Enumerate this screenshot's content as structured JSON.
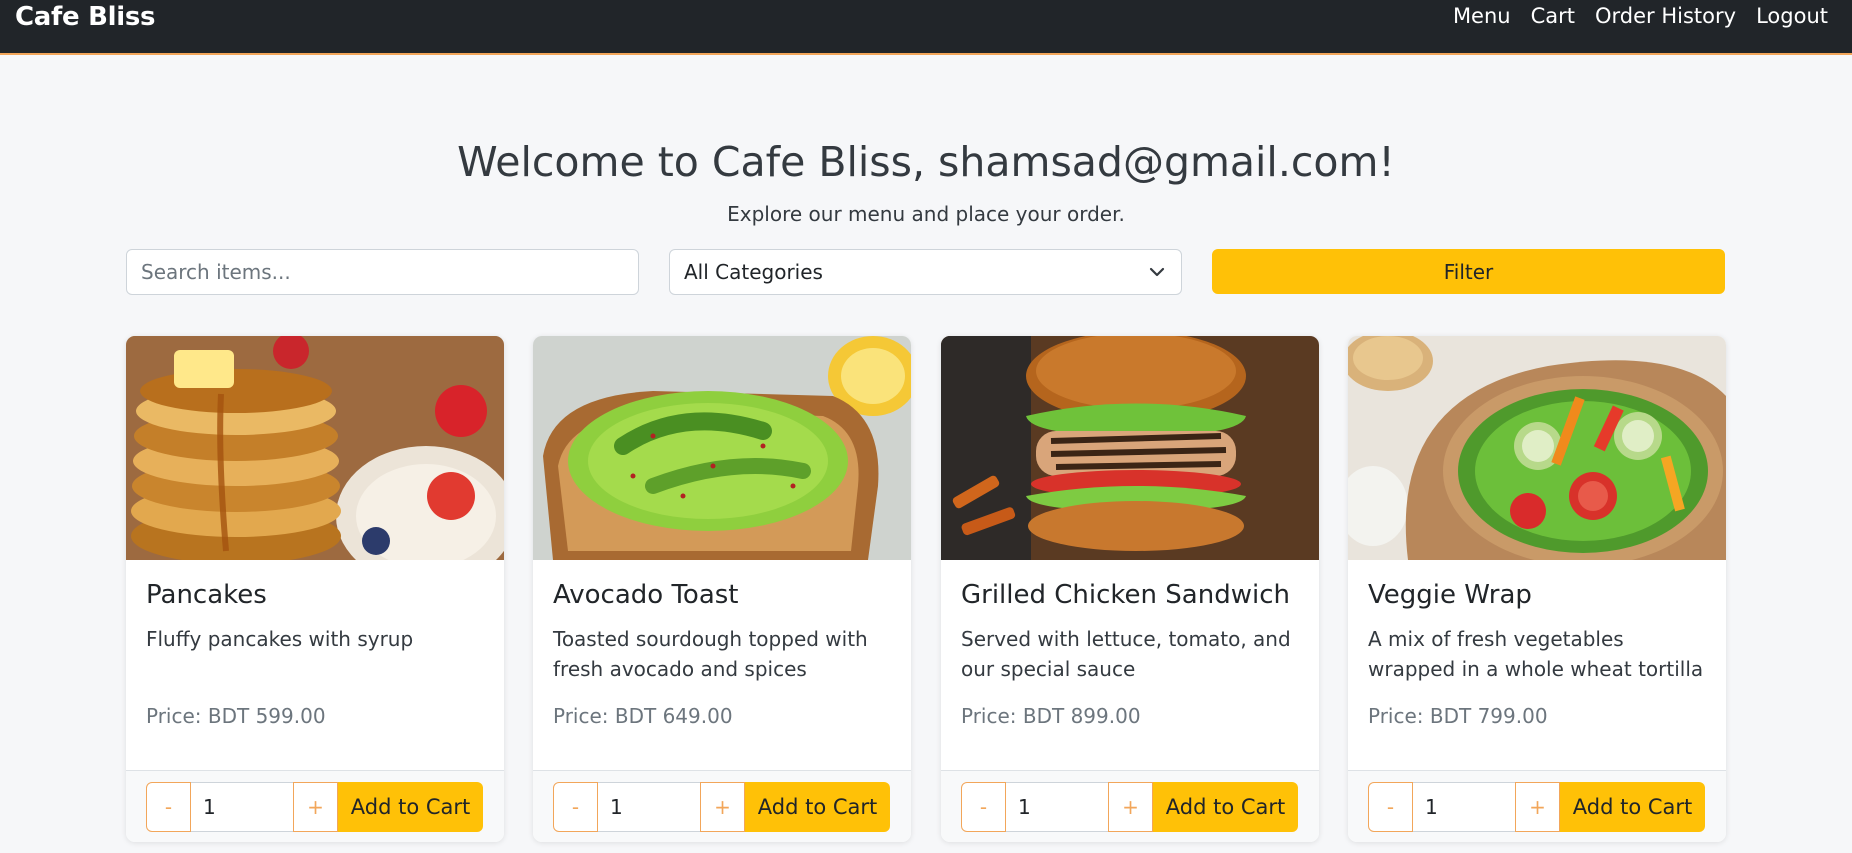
{
  "app": {
    "brand": "Cafe Bliss"
  },
  "nav": {
    "items": [
      "Menu",
      "Cart",
      "Order History",
      "Logout"
    ]
  },
  "hero": {
    "welcome": "Welcome to Cafe Bliss, shamsad@gmail.com!",
    "subtitle": "Explore our menu and place your order."
  },
  "filters": {
    "search_placeholder": "Search items...",
    "search_value": "",
    "category_value": "All Categories",
    "filter_label": "Filter"
  },
  "colors": {
    "navbar": "#212529",
    "accent": "#ffc107",
    "outline": "#f2a65a"
  },
  "items": [
    {
      "name": "Pancakes",
      "description": "Fluffy pancakes with syrup",
      "price": "Price: BDT 599.00",
      "qty": "1",
      "minus": "-",
      "plus": "+",
      "add_label": "Add to Cart",
      "image_icon": "pancakes-image"
    },
    {
      "name": "Avocado Toast",
      "description": "Toasted sourdough topped with fresh avocado and spices",
      "price": "Price: BDT 649.00",
      "qty": "1",
      "minus": "-",
      "plus": "+",
      "add_label": "Add to Cart",
      "image_icon": "avocado-toast-image"
    },
    {
      "name": "Grilled Chicken Sandwich",
      "description": "Served with lettuce, tomato, and our special sauce",
      "price": "Price: BDT 899.00",
      "qty": "1",
      "minus": "-",
      "plus": "+",
      "add_label": "Add to Cart",
      "image_icon": "chicken-sandwich-image"
    },
    {
      "name": "Veggie Wrap",
      "description": "A mix of fresh vegetables wrapped in a whole wheat tortilla",
      "price": "Price: BDT 799.00",
      "qty": "1",
      "minus": "-",
      "plus": "+",
      "add_label": "Add to Cart",
      "image_icon": "veggie-wrap-image"
    }
  ]
}
